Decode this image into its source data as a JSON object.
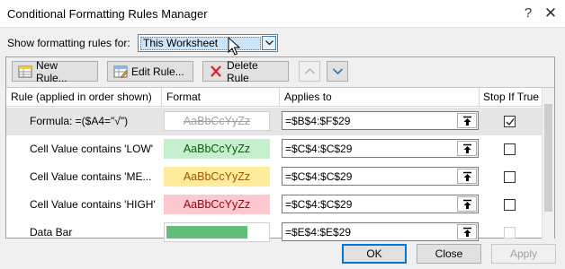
{
  "window": {
    "title": "Conditional Formatting Rules Manager",
    "help_glyph": "?",
    "close_glyph": "✕"
  },
  "scope": {
    "label": "Show formatting rules for:",
    "selected": "This Worksheet"
  },
  "toolbar": {
    "new_label": "New Rule...",
    "edit_label": "Edit Rule...",
    "delete_label": "Delete Rule"
  },
  "table": {
    "headers": [
      "Rule (applied in order shown)",
      "Format",
      "Applies to",
      "Stop If True"
    ],
    "rows": [
      {
        "rule": "Formula: =($A4=\"√\")",
        "format_sample": "AaBbCcYyZz",
        "applies_to": "=$B$4:$F$29",
        "stop_if_true": true,
        "selected": true
      },
      {
        "rule": "Cell Value contains 'LOW'",
        "format_sample": "AaBbCcYyZz",
        "applies_to": "=$C$4:$C$29",
        "stop_if_true": false
      },
      {
        "rule": "Cell Value contains 'ME...",
        "format_sample": "AaBbCcYyZz",
        "applies_to": "=$C$4:$C$29",
        "stop_if_true": false
      },
      {
        "rule": "Cell Value contains 'HIGH'",
        "format_sample": "AaBbCcYyZz",
        "applies_to": "=$C$4:$C$29",
        "stop_if_true": false
      },
      {
        "rule": "Data Bar",
        "format_sample": "",
        "applies_to": "=$E$4:$E$29",
        "stop_if_true": false,
        "stop_disabled": true
      }
    ]
  },
  "footer": {
    "ok_label": "OK",
    "close_label": "Close",
    "apply_label": "Apply"
  },
  "colors": {
    "selection": "#cce4f7",
    "ok_border": "#0078d7",
    "low_fill": "#c6efce",
    "medium_fill": "#ffeb9c",
    "high_fill": "#ffc7ce",
    "data_bar": "#63be7b"
  }
}
